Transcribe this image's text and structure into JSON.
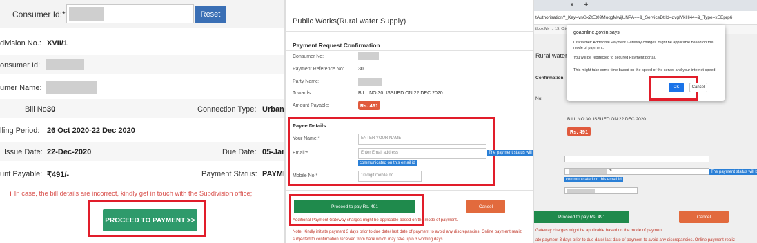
{
  "panel1": {
    "consumer_id_label": "Consumer Id:*",
    "reset_label": "Reset",
    "subdivision_label": "division No.:",
    "subdivision_value": "XVII/1",
    "consumer_id2_label": "onsumer Id:",
    "consumer_name_label": "umer Name:",
    "bill_no_label": "Bill No:",
    "bill_no_value": "30",
    "connection_type_label": "Connection Type:",
    "connection_type_value": "Urban",
    "billing_period_label": "lling Period:",
    "billing_period_value": "26 Oct 2020-22 Dec 2020",
    "issue_date_label": "Issue Date:",
    "issue_date_value": "22-Dec-2020",
    "due_date_label": "Due Date:",
    "due_date_value": "05-Jan",
    "amount_payable_label": "unt Payable:",
    "amount_payable_value": "₹491/-",
    "payment_status_label": "Payment Status:",
    "payment_status_value": "PAYME",
    "note_icon": "info-icon",
    "note": "In case, the bill details are incorrect, kindly get in touch with the Subdivision office;",
    "proceed_label": "PROCEED TO PAYMENT >>"
  },
  "panel2": {
    "header": "Public Works(Rural water Supply)",
    "section_title": "Payment Request Confirmation",
    "consumer_no_label": "Consumer No:",
    "payment_ref_label": "Payment Reference No:",
    "payment_ref_value": "30",
    "party_name_label": "Party Name:",
    "towards_label": "Towards:",
    "towards_value": "BILL NO:30; ISSUED ON:22 DEC 2020",
    "amount_label": "Amount Payable:",
    "amount_value": "Rs. 491",
    "payee_title": "Payee Details:",
    "your_name_label": "Your Name:*",
    "your_name_placeholder": "ENTER YOUR NAME",
    "email_label": "Email:*",
    "email_placeholder": "Enter Email address",
    "email_hint_1": "The payment status will b",
    "email_hint_2": "communicated on this email id",
    "mobile_label": "Mobile No:*",
    "mobile_placeholder": "10 digit mobile no",
    "pay_label": "Proceed to pay Rs. 491",
    "cancel_label": "Cancel",
    "warn_1": "Additional Payment Gateway charges might be applicable based on the mode of payment.",
    "warn_2": "Note: Kindly initiate payment 3 days prior to due date/ last date of payment to avoid any discrepancies. Online payment realiz",
    "warn_3": "subjected to confirmation received from bank which may take upto 3 working days."
  },
  "panel3": {
    "tab_close": "×",
    "tab_new": "+",
    "url": "tAuthorisation?_Key=vnGkZtEt09MoqgMwijUNPA==&_ServiceDtlId=qvgIVkHl44=&_Type=xEEprp6",
    "bookmarks": "tlook   My ...                                                                                           19; Cricket Sc...",
    "bg_title": "Rural water S",
    "bg_confirmation": "Confirmation",
    "bg_no": "No:",
    "dialog_title": "goaonline.gov.in says",
    "dialog_line1": "Disclaimer: Additional Payment Gateway charges might be applicable based on the mode of payment.",
    "dialog_line2": "You will be redirected to secured Payment portal.",
    "dialog_line3": "This might take some time based on the speed of the server and your internet speed.",
    "ok_label": "OK",
    "cancel_label": "Cancel",
    "bill_text": "BILL NO:30; ISSUED ON:22 DEC 2020",
    "amount_value": "Rs. 491",
    "email_suffix": "m",
    "email_hint_1": "The payment status will b",
    "email_hint_2": "communicated on this email id",
    "pay_label": "Proceed to pay Rs. 491",
    "cancel_bottom_label": "Cancel",
    "warn_1": "Gateway charges might be applicable based on the mode of payment.",
    "warn_2": "ate payment 3 days prior to due date/ last date of payment to avoid any discrepancies. Online payment realiz"
  },
  "colors": {
    "highlight": "#e11d2a",
    "green_button": "#2e9a6b",
    "reset_button": "#3a6fb5",
    "amount_badge": "#e05a3d",
    "ok_button": "#1a73e8"
  }
}
